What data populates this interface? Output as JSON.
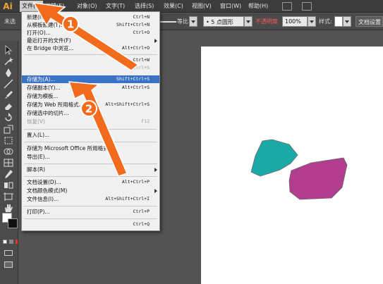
{
  "app": {
    "logo": "Ai"
  },
  "menubar": {
    "items": [
      {
        "label": "文件(F)"
      },
      {
        "label": "编辑(E)"
      },
      {
        "label": "对象(O)"
      },
      {
        "label": "文字(T)"
      },
      {
        "label": "选择(S)"
      },
      {
        "label": "效果(C)"
      },
      {
        "label": "视图(V)"
      },
      {
        "label": "窗口(W)"
      },
      {
        "label": "帮助(H)"
      }
    ]
  },
  "controlbar": {
    "left_label": "未选",
    "stroke_profile": "等比",
    "brush": "5 点圆形",
    "opacity_label": "不透明度",
    "opacity_value": "100%",
    "style_label": "样式:",
    "doc_settings": "文档设置"
  },
  "file_menu": {
    "items": [
      {
        "label": "新建(N)...",
        "shortcut": "Ctrl+N",
        "state": "normal"
      },
      {
        "label": "从模板新建(T)...",
        "shortcut": "Shift+Ctrl+N",
        "state": "normal"
      },
      {
        "label": "打开(O)...",
        "shortcut": "Ctrl+O",
        "state": "normal"
      },
      {
        "label": "最近打开的文件(F)",
        "shortcut": "",
        "state": "submenu"
      },
      {
        "label": "在 Bridge 中浏览...",
        "shortcut": "Alt+Ctrl+O",
        "state": "normal"
      },
      {
        "label": "",
        "shortcut": "Ctrl+W",
        "state": "normal"
      },
      {
        "label": "",
        "shortcut": "Ctrl+S",
        "state": "disabled"
      },
      {
        "label": "存储为(A)...",
        "shortcut": "Shift+Ctrl+S",
        "state": "highlight"
      },
      {
        "label": "存储副本(Y)...",
        "shortcut": "Alt+Ctrl+S",
        "state": "normal"
      },
      {
        "label": "存储为模板...",
        "shortcut": "",
        "state": "normal"
      },
      {
        "label": "存储为 Web 所用格式...",
        "shortcut": "Alt+Shift+Ctrl+S",
        "state": "normal"
      },
      {
        "label": "存储选中的切片...",
        "shortcut": "",
        "state": "normal"
      },
      {
        "label": "恢复(V)",
        "shortcut": "F12",
        "state": "disabled"
      },
      {
        "label": "置入(L)...",
        "shortcut": "",
        "state": "normal"
      },
      {
        "label": "存储为 Microsoft Office 所用格式...",
        "shortcut": "",
        "state": "normal"
      },
      {
        "label": "导出(E)...",
        "shortcut": "",
        "state": "normal"
      },
      {
        "label": "脚本(R)",
        "shortcut": "",
        "state": "submenu"
      },
      {
        "label": "文档设置(D)...",
        "shortcut": "Alt+Ctrl+P",
        "state": "normal"
      },
      {
        "label": "文档颜色模式(M)",
        "shortcut": "",
        "state": "submenu"
      },
      {
        "label": "文件信息(I)...",
        "shortcut": "Alt+Shift+Ctrl+I",
        "state": "normal"
      },
      {
        "label": "打印(P)...",
        "shortcut": "Ctrl+P",
        "state": "normal"
      },
      {
        "label": "",
        "shortcut": "Ctrl+Q",
        "state": "normal"
      }
    ]
  },
  "annotations": {
    "badge1": "1",
    "badge2": "2",
    "arrow_color": "#f26a1b"
  },
  "shapes": {
    "teal": "#1aaaa5",
    "magenta": "#b23c8e"
  }
}
